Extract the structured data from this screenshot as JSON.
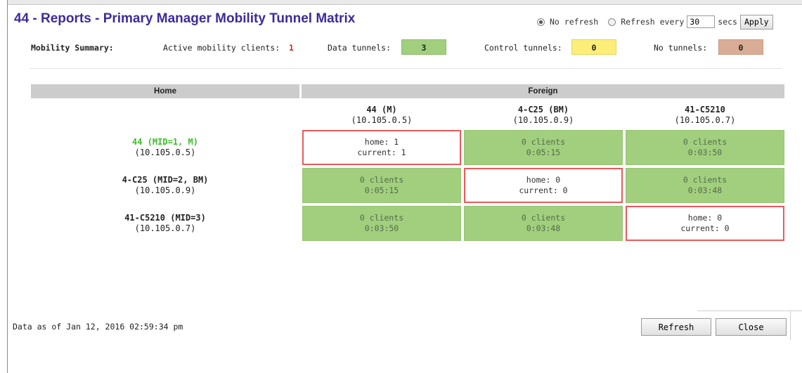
{
  "title": "44 - Reports - Primary Manager Mobility Tunnel Matrix",
  "refresh": {
    "no_refresh_label": "No refresh",
    "refresh_every_label": "Refresh every",
    "interval_value": "30",
    "secs_label": "secs",
    "apply_label": "Apply",
    "selected": "no_refresh"
  },
  "summary": {
    "label": "Mobility Summary:",
    "active_label": "Active mobility clients:",
    "active_value": "1",
    "data_label": "Data tunnels:",
    "data_value": "3",
    "control_label": "Control tunnels:",
    "control_value": "0",
    "none_label": "No tunnels:",
    "none_value": "0"
  },
  "matrix": {
    "home_header": "Home",
    "foreign_header": "Foreign",
    "columns": [
      {
        "name": "44 (M)",
        "ip": "(10.105.0.5)"
      },
      {
        "name": "4-C25 (BM)",
        "ip": "(10.105.0.9)"
      },
      {
        "name": "41-C5210",
        "ip": "(10.105.0.7)"
      }
    ],
    "rows": [
      {
        "name": "44 (MID=1, M)",
        "ip": "(10.105.0.5)",
        "cells": [
          [
            "home: 1",
            "current: 1"
          ],
          [
            "0 clients",
            "0:05:15"
          ],
          [
            "0 clients",
            "0:03:50"
          ]
        ]
      },
      {
        "name": "4-C25 (MID=2, BM)",
        "ip": "(10.105.0.9)",
        "cells": [
          [
            "0 clients",
            "0:05:15"
          ],
          [
            "home: 0",
            "current: 0"
          ],
          [
            "0 clients",
            "0:03:48"
          ]
        ]
      },
      {
        "name": "41-C5210 (MID=3)",
        "ip": "(10.105.0.7)",
        "cells": [
          [
            "0 clients",
            "0:03:50"
          ],
          [
            "0 clients",
            "0:03:48"
          ],
          [
            "home: 0",
            "current: 0"
          ]
        ]
      }
    ]
  },
  "footer": {
    "as_of": "Data as of Jan 12, 2016 02:59:34 pm",
    "refresh_label": "Refresh",
    "close_label": "Close"
  },
  "colors": {
    "title": "#3d2a9c",
    "tunnel_green": "#a1cf7e",
    "control_yellow": "#fdee7a",
    "no_tunnel_tan": "#d9ad95",
    "self_cell_border": "#ea5a5a",
    "local_home_name": "#3cbd2c",
    "active_count": "#d0231f"
  }
}
